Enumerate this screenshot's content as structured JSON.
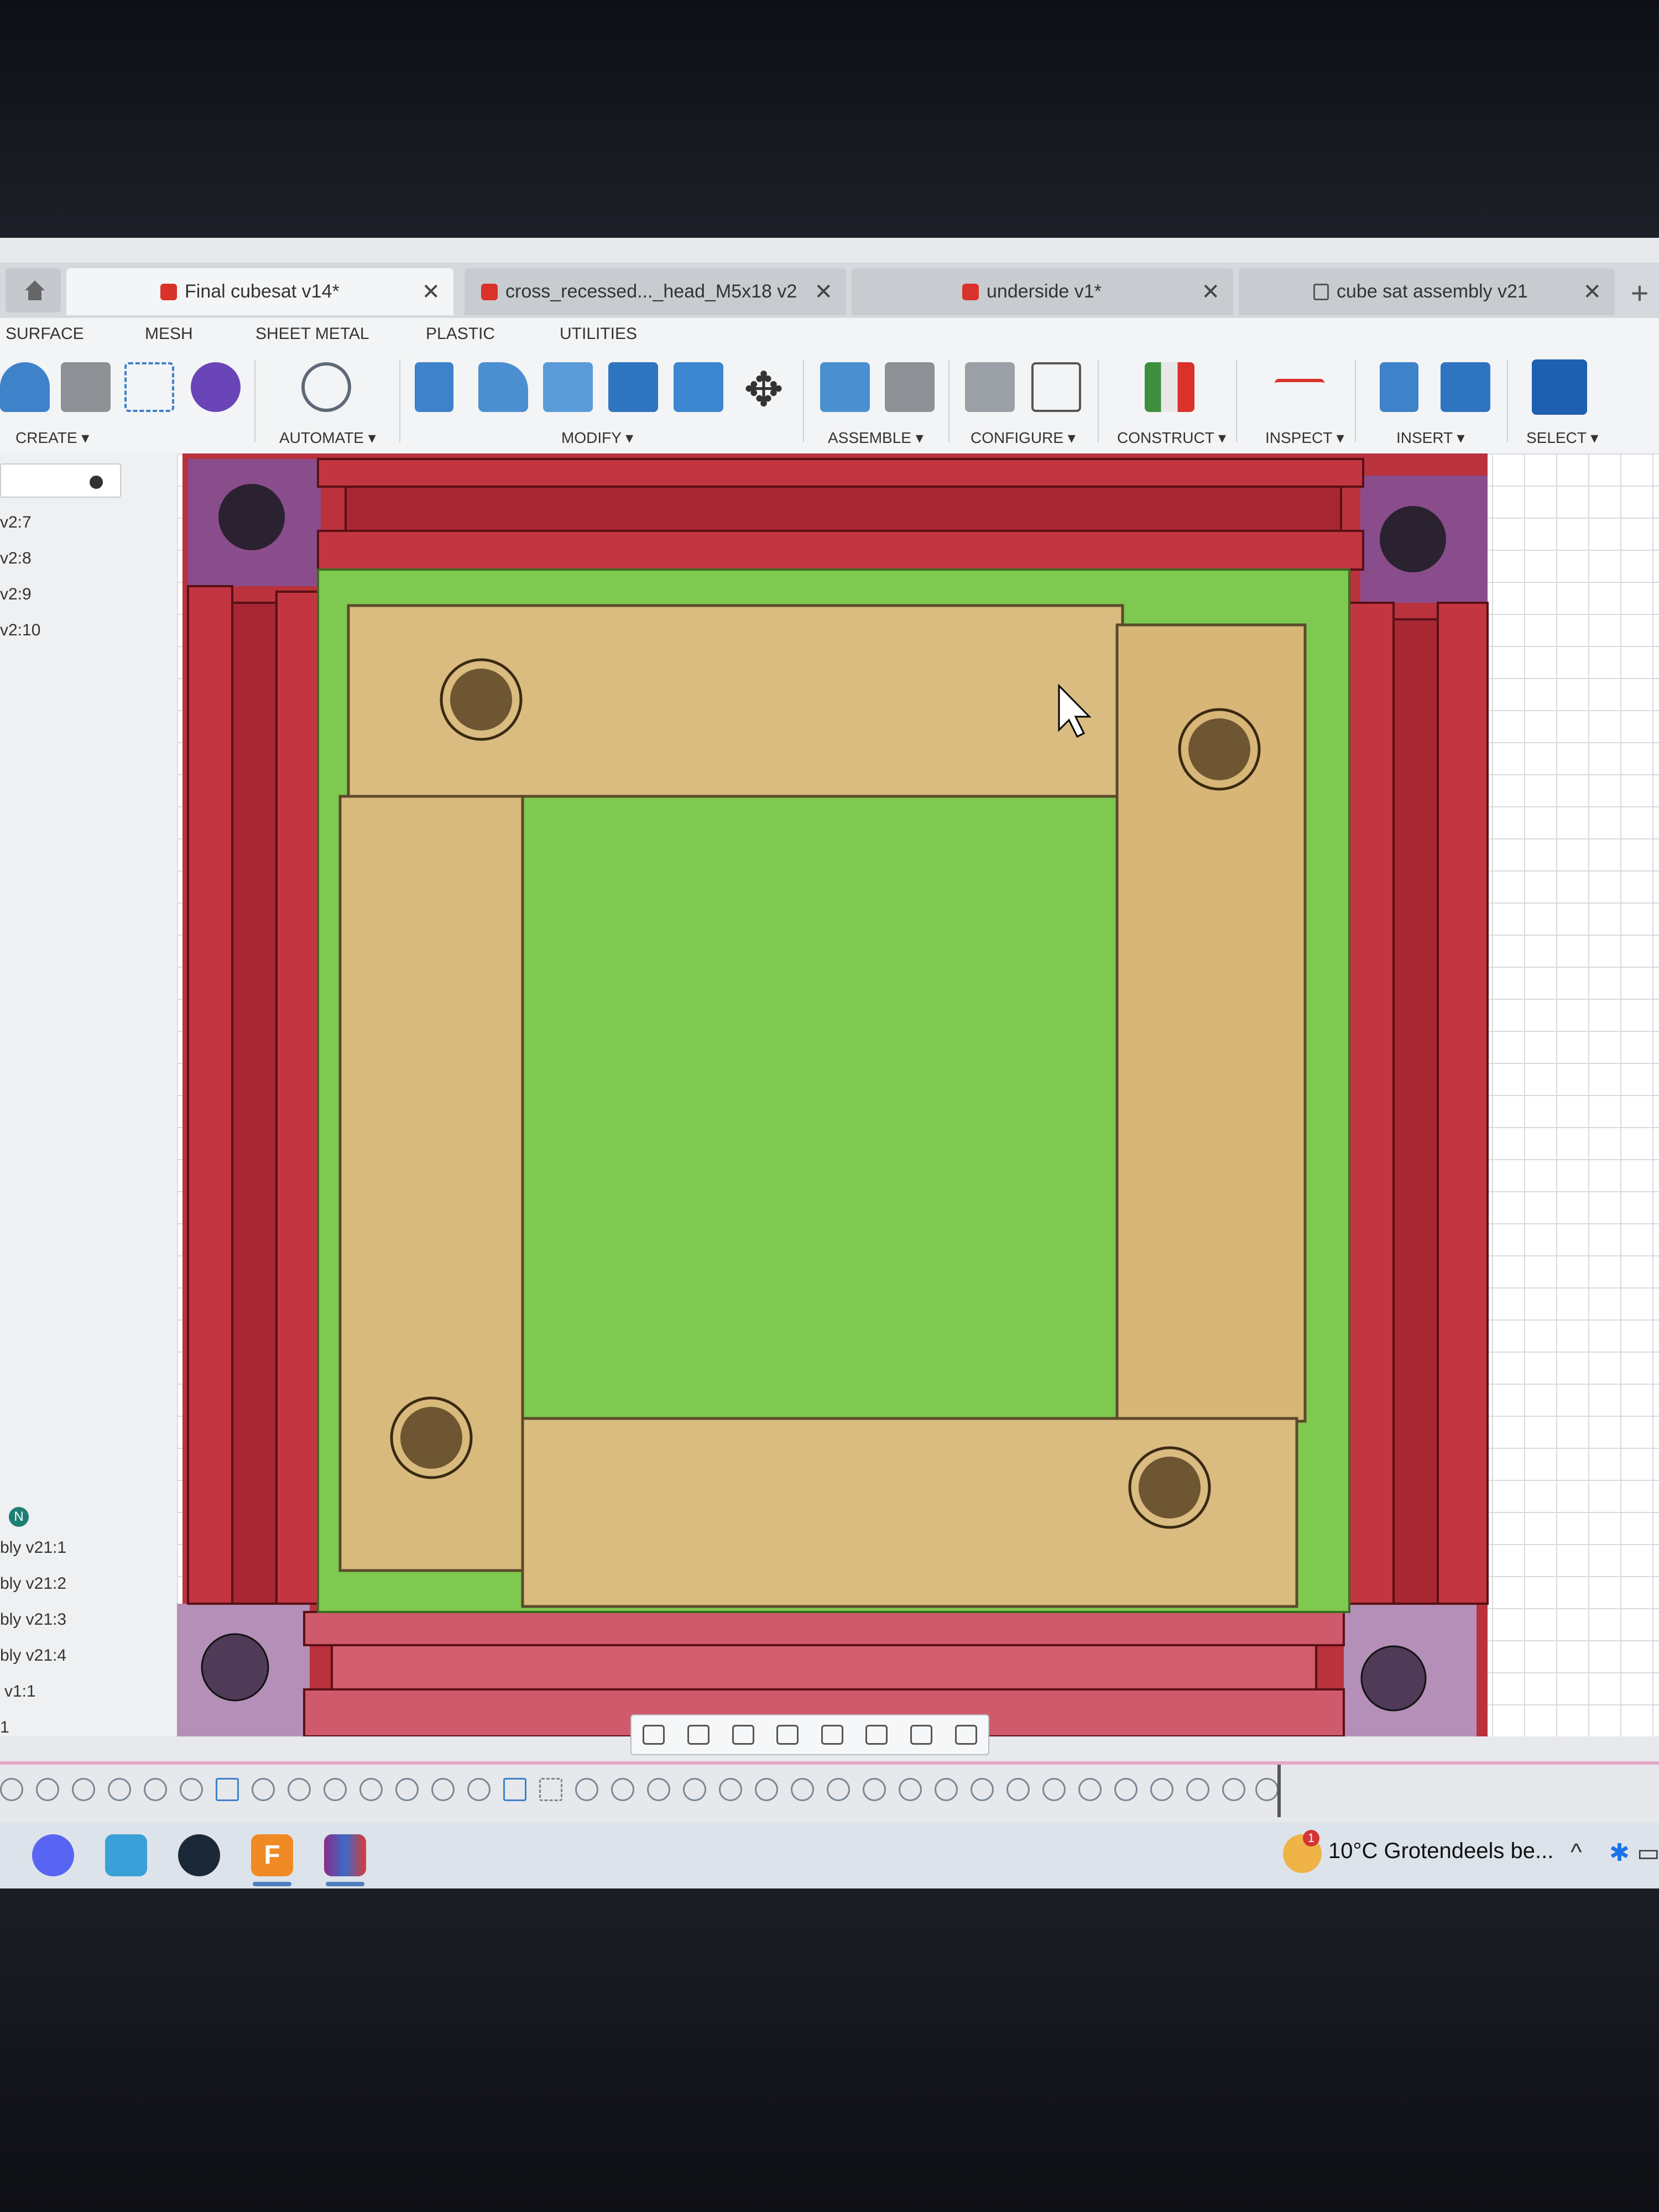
{
  "tabs": [
    {
      "label": "Final cubesat v14*",
      "icon": "part-cube-icon",
      "active": true
    },
    {
      "label": "cross_recessed..._head_M5x18 v2",
      "icon": "part-cube-icon",
      "active": false
    },
    {
      "label": "underside v1*",
      "icon": "part-cube-icon",
      "active": false
    },
    {
      "label": "cube sat assembly v21",
      "icon": "lock-icon",
      "active": false
    }
  ],
  "ribbon": {
    "tabs": [
      "SURFACE",
      "MESH",
      "SHEET METAL",
      "PLASTIC",
      "UTILITIES"
    ],
    "groups": [
      "CREATE ▾",
      "AUTOMATE ▾",
      "MODIFY ▾",
      "ASSEMBLE ▾",
      "CONFIGURE ▾",
      "CONSTRUCT ▾",
      "INSPECT ▾",
      "INSERT ▾",
      "SELECT ▾"
    ]
  },
  "browser": {
    "items_top": [
      "v2:7",
      "v2:8",
      "v2:9",
      "v2:10"
    ],
    "badge": "N",
    "items_bottom": [
      "bly v21:1",
      "bly v21:2",
      "bly v21:3",
      "bly v21:4",
      "v1:1",
      "1"
    ]
  },
  "taskbar": {
    "weather": "10°C  Grotendeels be...",
    "weather_badge": "1",
    "fusion_label": "F",
    "apps": [
      "discord-icon",
      "desktop-icon",
      "steam-icon",
      "fusion360-icon",
      "winrar-icon"
    ]
  },
  "colors": {
    "frame_red": "#c72f3a",
    "corner_purple": "#8c4f8e",
    "plate_tan": "#d9b980",
    "board_green": "#7ec94f"
  }
}
